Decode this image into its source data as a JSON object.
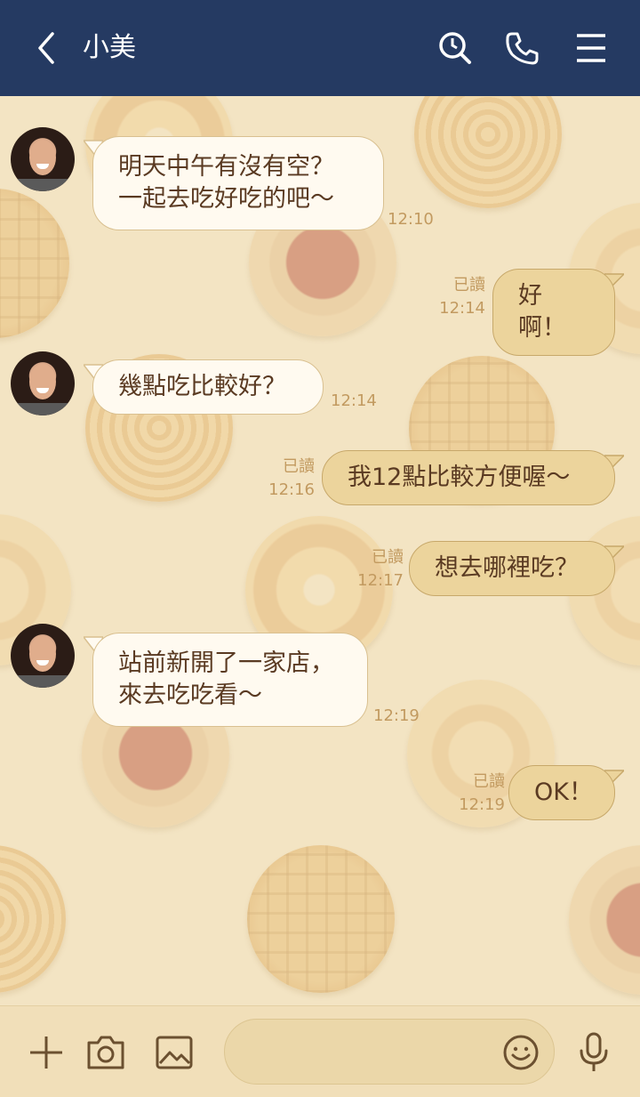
{
  "header": {
    "title": "小美",
    "back_icon": "chevron-left-icon",
    "search_icon": "search-icon",
    "call_icon": "phone-icon",
    "menu_icon": "menu-icon",
    "background": "#253a62"
  },
  "messages": [
    {
      "direction": "in",
      "text": "明天中午有沒有空？\n一起去吃好吃的吧～",
      "time": "12:10"
    },
    {
      "direction": "out",
      "text": "好啊！",
      "read": "已讀",
      "time": "12:14"
    },
    {
      "direction": "in",
      "text": "幾點吃比較好？",
      "time": "12:14"
    },
    {
      "direction": "out",
      "text": "我12點比較方便喔～",
      "read": "已讀",
      "time": "12:16"
    },
    {
      "direction": "out",
      "text": "想去哪裡吃？",
      "read": "已讀",
      "time": "12:17"
    },
    {
      "direction": "in",
      "text": "站前新開了一家店，\n來去吃吃看～",
      "time": "12:19"
    },
    {
      "direction": "out",
      "text": "OK！",
      "read": "已讀",
      "time": "12:19"
    }
  ],
  "input": {
    "placeholder": "",
    "plus_icon": "plus-icon",
    "camera_icon": "camera-icon",
    "image_icon": "image-icon",
    "emoji_icon": "emoji-icon",
    "mic_icon": "microphone-icon"
  }
}
